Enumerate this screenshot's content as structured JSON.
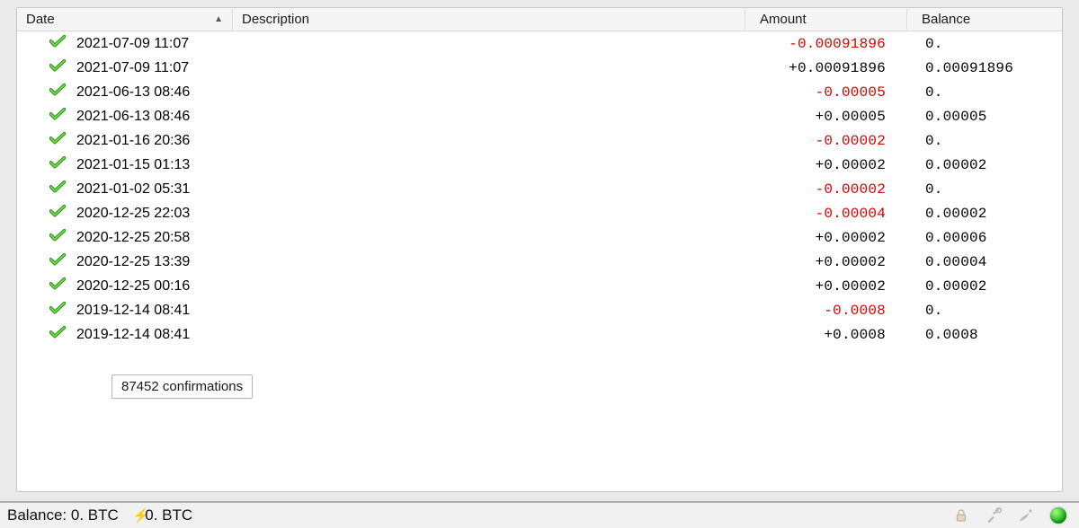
{
  "columns": {
    "date": "Date",
    "sort_indicator": "▲",
    "description": "Description",
    "amount": "Amount",
    "balance": "Balance"
  },
  "transactions": [
    {
      "date": "2021-07-09 11:07",
      "description": "",
      "amount": "-0.00091896",
      "amount_sign": "neg",
      "balance": "0."
    },
    {
      "date": "2021-07-09 11:07",
      "description": "",
      "amount": "+0.00091896",
      "amount_sign": "pos",
      "balance": "0.00091896"
    },
    {
      "date": "2021-06-13 08:46",
      "description": "",
      "amount": "-0.00005",
      "amount_sign": "neg",
      "balance": "0."
    },
    {
      "date": "2021-06-13 08:46",
      "description": "",
      "amount": "+0.00005",
      "amount_sign": "pos",
      "balance": "0.00005"
    },
    {
      "date": "2021-01-16 20:36",
      "description": "",
      "amount": "-0.00002",
      "amount_sign": "neg",
      "balance": "0."
    },
    {
      "date": "2021-01-15 01:13",
      "description": "",
      "amount": "+0.00002",
      "amount_sign": "pos",
      "balance": "0.00002"
    },
    {
      "date": "2021-01-02 05:31",
      "description": "",
      "amount": "-0.00002",
      "amount_sign": "neg",
      "balance": "0."
    },
    {
      "date": "2020-12-25 22:03",
      "description": "",
      "amount": "-0.00004",
      "amount_sign": "neg",
      "balance": "0.00002"
    },
    {
      "date": "2020-12-25 20:58",
      "description": "",
      "amount": "+0.00002",
      "amount_sign": "pos",
      "balance": "0.00006"
    },
    {
      "date": "2020-12-25 13:39",
      "description": "",
      "amount": "+0.00002",
      "amount_sign": "pos",
      "balance": "0.00004"
    },
    {
      "date": "2020-12-25 00:16",
      "description": "",
      "amount": "+0.00002",
      "amount_sign": "pos",
      "balance": "0.00002"
    },
    {
      "date": "2019-12-14 08:41",
      "description": "",
      "amount": "-0.0008",
      "amount_sign": "neg",
      "balance": "0."
    },
    {
      "date": "2019-12-14 08:41",
      "description": "",
      "amount": "+0.0008",
      "amount_sign": "pos",
      "balance": "0.0008"
    }
  ],
  "tooltip": "87452 confirmations",
  "status": {
    "balance_label": "Balance:",
    "balance_value": "0. BTC",
    "lightning_value": "0. BTC"
  },
  "icons": {
    "confirmed": "check-icon",
    "lock": "lock-icon",
    "tools": "tools-icon",
    "seed": "seed-icon",
    "led": "network-led-icon"
  },
  "colors": {
    "negative": "#d40000",
    "positive": "#000000",
    "confirm_check": "#2fb51f"
  }
}
